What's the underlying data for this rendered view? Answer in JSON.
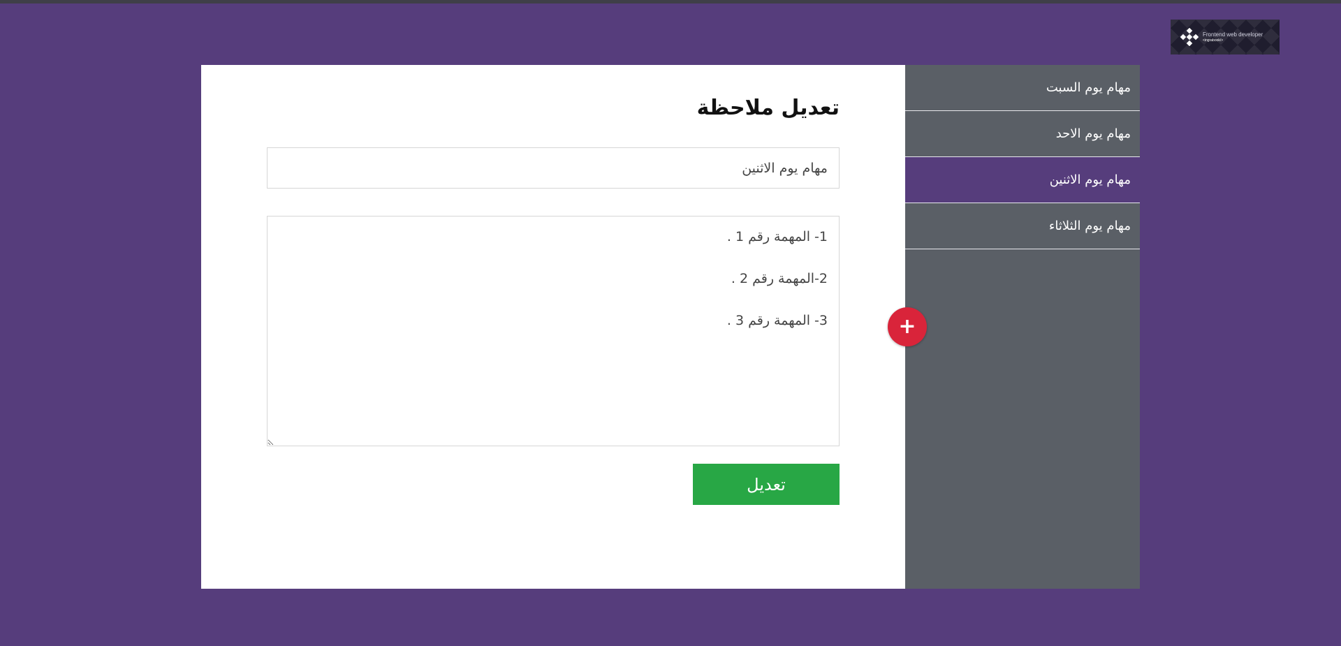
{
  "logo": {
    "line1": "Frontend web developer",
    "line2": "<ingrabook/>"
  },
  "sidebar": {
    "items": [
      {
        "label": "مهام يوم السبت",
        "active": false
      },
      {
        "label": "مهام يوم الاحد",
        "active": false
      },
      {
        "label": "مهام يوم الاثنين",
        "active": true
      },
      {
        "label": "مهام يوم الثلاثاء",
        "active": false
      }
    ]
  },
  "editor": {
    "heading": "تعديل ملاحظة",
    "title_value": "مهام يوم الاثنين",
    "body_lines": [
      "1- المهمة رقم 1 .",
      "2-المهمة رقم 2 .",
      "3- المهمة رقم 3 ."
    ],
    "submit_label": "تعديل"
  },
  "fab": {
    "label": "+",
    "icon": "plus-icon"
  },
  "colors": {
    "background": "#563d7c",
    "sidebar": "#5a5f66",
    "active_item": "#563d7c",
    "submit": "#28a745",
    "fab": "#d9243a"
  }
}
